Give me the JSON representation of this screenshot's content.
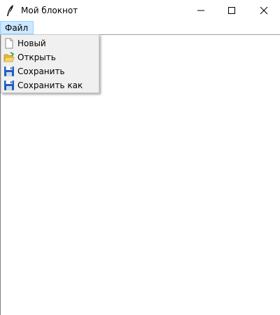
{
  "window": {
    "title": "Мой блокнот",
    "icon": "feather-icon",
    "controls": [
      "minimize-icon",
      "maximize-icon",
      "close-icon"
    ]
  },
  "menubar": {
    "items": [
      {
        "label": "Файл"
      }
    ]
  },
  "file_menu": {
    "items": [
      {
        "label": "Новый",
        "icon": "new-file-icon"
      },
      {
        "label": "Открыть",
        "icon": "open-folder-icon"
      },
      {
        "label": "Сохранить",
        "icon": "save-icon"
      },
      {
        "label": "Сохранить как",
        "icon": "save-as-icon"
      }
    ]
  },
  "editor": {
    "text": ""
  },
  "colors": {
    "menu_highlight": "#cce8ff",
    "menu_background": "#f0f0f0",
    "save_icon_blue": "#1f5fbf"
  }
}
